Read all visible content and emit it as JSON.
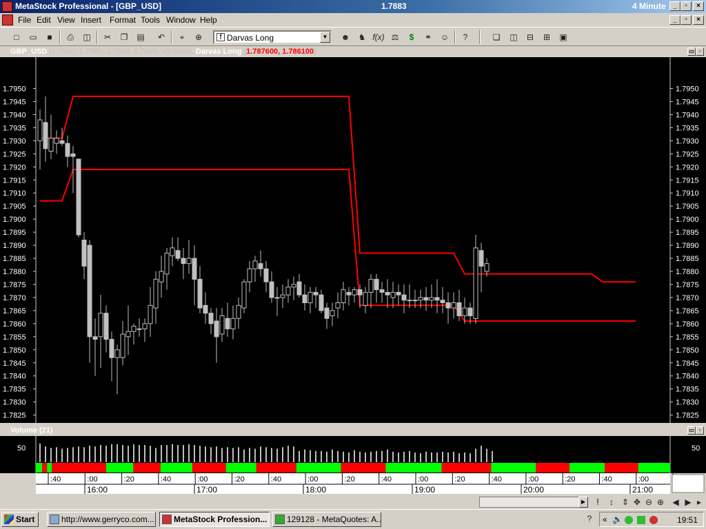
{
  "window": {
    "title": "MetaStock Professional - [GBP_USD]",
    "center_value": "1.7883",
    "interval": "4 Minute"
  },
  "menu": [
    "File",
    "Edit",
    "View",
    "Insert",
    "Format",
    "Tools",
    "Window",
    "Help"
  ],
  "toolbar": {
    "expert_combo": "Darvas Long"
  },
  "price_pane": {
    "instrument": "GBP_USD",
    "ohlc": "(1.7880, 1.7885, 1.7878, 1.7883, +0.0002),",
    "indicator": "Darvas Long",
    "indicator_values": "1.787600, 1.786100",
    "y_ticks": [
      "1.7950",
      "1.7945",
      "1.7940",
      "1.7935",
      "1.7930",
      "1.7925",
      "1.7920",
      "1.7915",
      "1.7910",
      "1.7905",
      "1.7900",
      "1.7895",
      "1.7890",
      "1.7885",
      "1.7880",
      "1.7875",
      "1.7870",
      "1.7865",
      "1.7860",
      "1.7855",
      "1.7850",
      "1.7845",
      "1.7840",
      "1.7835",
      "1.7830",
      "1.7825"
    ]
  },
  "volume_pane": {
    "title": "Volume (21)",
    "tick": "50"
  },
  "time_axis": {
    "minor": [
      ":40",
      ":00",
      ":20",
      ":40",
      ":00",
      ":20",
      ":40",
      ":00",
      ":20",
      ":40",
      ":00",
      ":20",
      ":40",
      ":00",
      ":20",
      ":40",
      ":00",
      ":20",
      ":40",
      ":00"
    ],
    "major": [
      "16:00",
      "17:00",
      "18:00",
      "19:00",
      "20:00",
      "21:00"
    ]
  },
  "chart_data": {
    "type": "candlestick",
    "y_unit": "GBP/USD",
    "ylim": [
      1.7822,
      1.7962
    ],
    "candles": [
      [
        1.793,
        1.7942,
        1.7919,
        1.7938
      ],
      [
        1.7937,
        1.7947,
        1.7922,
        1.7927
      ],
      [
        1.7926,
        1.794,
        1.7923,
        1.7931
      ],
      [
        1.7929,
        1.7934,
        1.7925,
        1.7931
      ],
      [
        1.793,
        1.7935,
        1.7928,
        1.7929
      ],
      [
        1.7929,
        1.7932,
        1.792,
        1.7924
      ],
      [
        1.7925,
        1.7928,
        1.791,
        1.7924
      ],
      [
        1.7923,
        1.7923,
        1.7893,
        1.7894
      ],
      [
        1.7892,
        1.7895,
        1.7877,
        1.7882
      ],
      [
        1.789,
        1.7892,
        1.7845,
        1.7855
      ],
      [
        1.7855,
        1.7862,
        1.784,
        1.7854
      ],
      [
        1.7855,
        1.7871,
        1.7843,
        1.7864
      ],
      [
        1.7864,
        1.7867,
        1.7849,
        1.7854
      ],
      [
        1.7854,
        1.7857,
        1.7838,
        1.7847
      ],
      [
        1.7847,
        1.7852,
        1.7833,
        1.785
      ],
      [
        1.7847,
        1.7861,
        1.7844,
        1.7856
      ],
      [
        1.7855,
        1.7867,
        1.7848,
        1.7857
      ],
      [
        1.7857,
        1.786,
        1.7852,
        1.7859
      ],
      [
        1.7858,
        1.7862,
        1.7855,
        1.7858
      ],
      [
        1.7858,
        1.7862,
        1.7853,
        1.786
      ],
      [
        1.786,
        1.7874,
        1.7855,
        1.7867
      ],
      [
        1.7866,
        1.788,
        1.786,
        1.7877
      ],
      [
        1.7876,
        1.7886,
        1.787,
        1.788
      ],
      [
        1.7879,
        1.7889,
        1.7873,
        1.7887
      ],
      [
        1.7886,
        1.7893,
        1.7882,
        1.7889
      ],
      [
        1.7888,
        1.7893,
        1.7884,
        1.7885
      ],
      [
        1.7885,
        1.7889,
        1.7877,
        1.7883
      ],
      [
        1.7883,
        1.7892,
        1.7879,
        1.7885
      ],
      [
        1.7885,
        1.789,
        1.7867,
        1.7877
      ],
      [
        1.7877,
        1.7882,
        1.7864,
        1.7866
      ],
      [
        1.7867,
        1.7872,
        1.786,
        1.7864
      ],
      [
        1.7864,
        1.7866,
        1.7856,
        1.786
      ],
      [
        1.7861,
        1.7866,
        1.7845,
        1.7855
      ],
      [
        1.7856,
        1.7866,
        1.7853,
        1.7863
      ],
      [
        1.7862,
        1.7868,
        1.7855,
        1.7858
      ],
      [
        1.7858,
        1.7867,
        1.7854,
        1.7862
      ],
      [
        1.7862,
        1.787,
        1.7858,
        1.7867
      ],
      [
        1.7866,
        1.7877,
        1.7864,
        1.7876
      ],
      [
        1.7876,
        1.7884,
        1.7872,
        1.7881
      ],
      [
        1.7881,
        1.7886,
        1.7876,
        1.7884
      ],
      [
        1.7883,
        1.7888,
        1.7878,
        1.7881
      ],
      [
        1.7881,
        1.7884,
        1.7872,
        1.7876
      ],
      [
        1.7876,
        1.788,
        1.7868,
        1.787
      ],
      [
        1.787,
        1.7874,
        1.7863,
        1.787
      ],
      [
        1.787,
        1.7875,
        1.7866,
        1.7871
      ],
      [
        1.7871,
        1.7877,
        1.7868,
        1.7874
      ],
      [
        1.7874,
        1.7878,
        1.7869,
        1.7875
      ],
      [
        1.7876,
        1.7879,
        1.787,
        1.7871
      ],
      [
        1.7871,
        1.7875,
        1.7865,
        1.7868
      ],
      [
        1.7868,
        1.7874,
        1.7864,
        1.7872
      ],
      [
        1.7872,
        1.7874,
        1.7866,
        1.7871
      ],
      [
        1.7871,
        1.7873,
        1.7864,
        1.7865
      ],
      [
        1.7866,
        1.7868,
        1.7858,
        1.7862
      ],
      [
        1.7863,
        1.7868,
        1.7859,
        1.7865
      ],
      [
        1.7866,
        1.7872,
        1.7862,
        1.7868
      ],
      [
        1.7868,
        1.7876,
        1.7865,
        1.7873
      ],
      [
        1.7872,
        1.7874,
        1.7867,
        1.7871
      ],
      [
        1.7871,
        1.7874,
        1.7868,
        1.7873
      ],
      [
        1.7873,
        1.7875,
        1.7866,
        1.7871
      ],
      [
        1.7867,
        1.7874,
        1.7864,
        1.7872
      ],
      [
        1.7872,
        1.7879,
        1.7866,
        1.7877
      ],
      [
        1.7877,
        1.7879,
        1.7868,
        1.7873
      ],
      [
        1.7873,
        1.7876,
        1.7868,
        1.7872
      ],
      [
        1.7872,
        1.7877,
        1.7866,
        1.7871
      ],
      [
        1.787,
        1.7876,
        1.7866,
        1.7872
      ],
      [
        1.7872,
        1.7875,
        1.7867,
        1.7871
      ],
      [
        1.7871,
        1.7875,
        1.7864,
        1.7869
      ],
      [
        1.7869,
        1.7875,
        1.7866,
        1.7869
      ],
      [
        1.7869,
        1.7873,
        1.7866,
        1.7869
      ],
      [
        1.7869,
        1.7873,
        1.7866,
        1.787
      ],
      [
        1.787,
        1.7874,
        1.7865,
        1.7869
      ],
      [
        1.7869,
        1.7875,
        1.7866,
        1.787
      ],
      [
        1.787,
        1.7877,
        1.7864,
        1.7869
      ],
      [
        1.7869,
        1.7874,
        1.7864,
        1.7868
      ],
      [
        1.7868,
        1.7872,
        1.786,
        1.7866
      ],
      [
        1.7866,
        1.7872,
        1.7862,
        1.7868
      ],
      [
        1.7868,
        1.7873,
        1.7861,
        1.7863
      ],
      [
        1.7863,
        1.787,
        1.786,
        1.7866
      ],
      [
        1.7866,
        1.7868,
        1.786,
        1.7863
      ],
      [
        1.7862,
        1.7894,
        1.786,
        1.7889
      ],
      [
        1.7888,
        1.7891,
        1.7872,
        1.7882
      ],
      [
        1.788,
        1.7885,
        1.7878,
        1.7883
      ]
    ],
    "series": [
      {
        "name": "Darvas Long",
        "color": "#ff0000",
        "lines": [
          [
            [
              0,
              1.7931
            ],
            [
              4,
              1.7931
            ],
            [
              6,
              1.7947
            ],
            [
              56,
              1.7947
            ],
            [
              58,
              1.7887
            ],
            [
              75,
              1.7887
            ],
            [
              77,
              1.7879
            ],
            [
              100,
              1.7879
            ],
            [
              102,
              1.7876
            ],
            [
              108,
              1.7876
            ]
          ],
          [
            [
              0,
              1.7907
            ],
            [
              4,
              1.7907
            ],
            [
              6,
              1.7919
            ],
            [
              56,
              1.7919
            ],
            [
              58,
              1.7867
            ],
            [
              75,
              1.7867
            ],
            [
              77,
              1.7861
            ],
            [
              108,
              1.7861
            ]
          ]
        ]
      }
    ],
    "volume": [
      50,
      42,
      38,
      40,
      36,
      38,
      40,
      42,
      40,
      44,
      42,
      46,
      44,
      48,
      48,
      46,
      44,
      48,
      46,
      46,
      44,
      38,
      46,
      46,
      48,
      46,
      46,
      48,
      46,
      44,
      42,
      40,
      42,
      38,
      40,
      38,
      40,
      34,
      38,
      36,
      42,
      40,
      38,
      36,
      40,
      44,
      42,
      30,
      34,
      32,
      30,
      30,
      28,
      34,
      30,
      28,
      26,
      32,
      28,
      26,
      28,
      30,
      30,
      34,
      28,
      26,
      28,
      30,
      26,
      24,
      28,
      26,
      26,
      28,
      26,
      28,
      24,
      26,
      24,
      36,
      44,
      36,
      30
    ],
    "volume_ylim": [
      0,
      70
    ],
    "volume_bar_colors": [
      "#00ff00",
      "#ff0000",
      "#00ff00",
      "#ff0000",
      "#00ff00",
      "#ff0000",
      "#00ff00",
      "#ff0000",
      "#00ff00",
      "#ff0000",
      "#00ff00",
      "#ff0000",
      "#00ff00",
      "#ff0000",
      "#00ff00",
      "#ff0000",
      "#00ff00",
      "#ff0000",
      "#00ff00"
    ],
    "volume_bar_shares": [
      4,
      3,
      3,
      34,
      17,
      17,
      20,
      21,
      19,
      25,
      28,
      28,
      35,
      31,
      28,
      21,
      22,
      21,
      20
    ]
  },
  "taskbar": {
    "start": "Start",
    "tasks": [
      "http://www.gerryco.com...",
      "MetaStock Profession...",
      "129128 - MetaQuotes: A..."
    ],
    "clock": "19:51"
  }
}
